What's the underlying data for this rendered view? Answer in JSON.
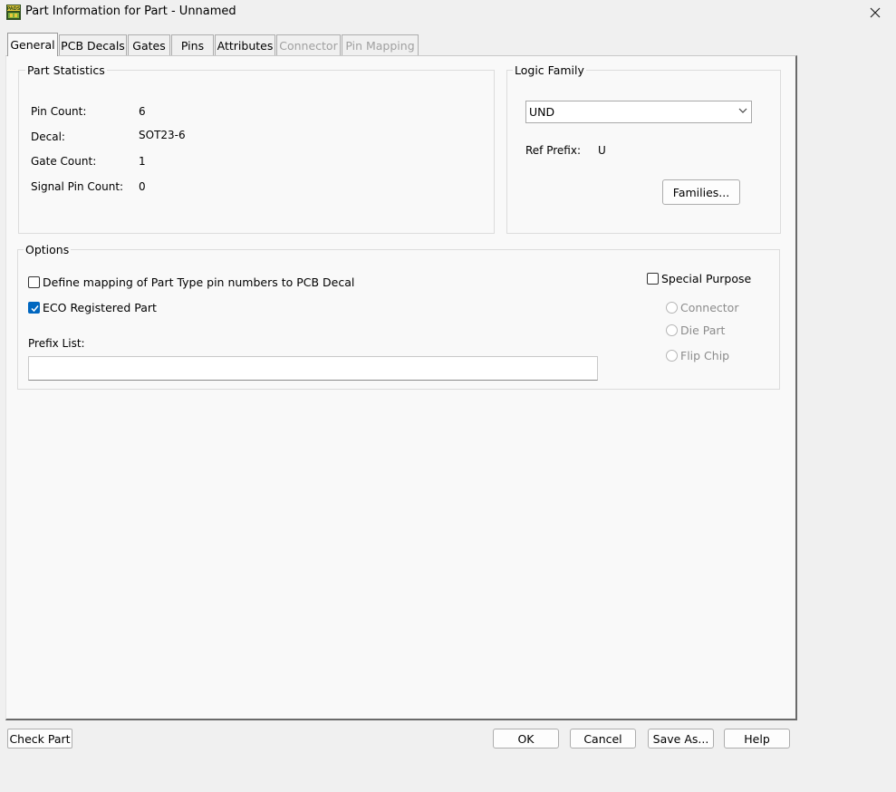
{
  "window": {
    "title": "Part Information for Part - Unnamed",
    "icon": "pads-logic-icon",
    "app_icon_text": "PADS"
  },
  "tabs": [
    {
      "label": "General",
      "active": true,
      "enabled": true
    },
    {
      "label": "PCB Decals",
      "active": false,
      "enabled": true
    },
    {
      "label": "Gates",
      "active": false,
      "enabled": true
    },
    {
      "label": "Pins",
      "active": false,
      "enabled": true
    },
    {
      "label": "Attributes",
      "active": false,
      "enabled": true
    },
    {
      "label": "Connector",
      "active": false,
      "enabled": false
    },
    {
      "label": "Pin Mapping",
      "active": false,
      "enabled": false
    }
  ],
  "part_statistics": {
    "title": "Part Statistics",
    "rows": [
      {
        "label": "Pin Count:",
        "value": "6"
      },
      {
        "label": "Decal:",
        "value": "SOT23-6"
      },
      {
        "label": "Gate Count:",
        "value": "1"
      },
      {
        "label": "Signal Pin Count:",
        "value": "0"
      }
    ]
  },
  "logic_family": {
    "title": "Logic Family",
    "selected": "UND",
    "ref_prefix_label": "Ref Prefix:",
    "ref_prefix_value": "U",
    "families_button": "Families..."
  },
  "options": {
    "title": "Options",
    "define_mapping": {
      "label": "Define mapping of Part Type pin numbers to PCB Decal",
      "checked": false
    },
    "eco_registered": {
      "label": "ECO Registered Part",
      "checked": true
    },
    "prefix_list_label": "Prefix List:",
    "prefix_list_value": "",
    "special_purpose": {
      "label": "Special Purpose",
      "checked": false
    },
    "special_options": [
      {
        "label": "Connector",
        "enabled": false
      },
      {
        "label": "Die Part",
        "enabled": false
      },
      {
        "label": "Flip Chip",
        "enabled": false
      }
    ]
  },
  "buttons": {
    "check_part": "Check Part",
    "ok": "OK",
    "cancel": "Cancel",
    "save_as": "Save As...",
    "help": "Help"
  },
  "colors": {
    "accent": "#0067c0",
    "panel_bg": "#f9f9f9",
    "window_bg": "#f0f0f0",
    "disabled_text": "#a0a0a0"
  }
}
